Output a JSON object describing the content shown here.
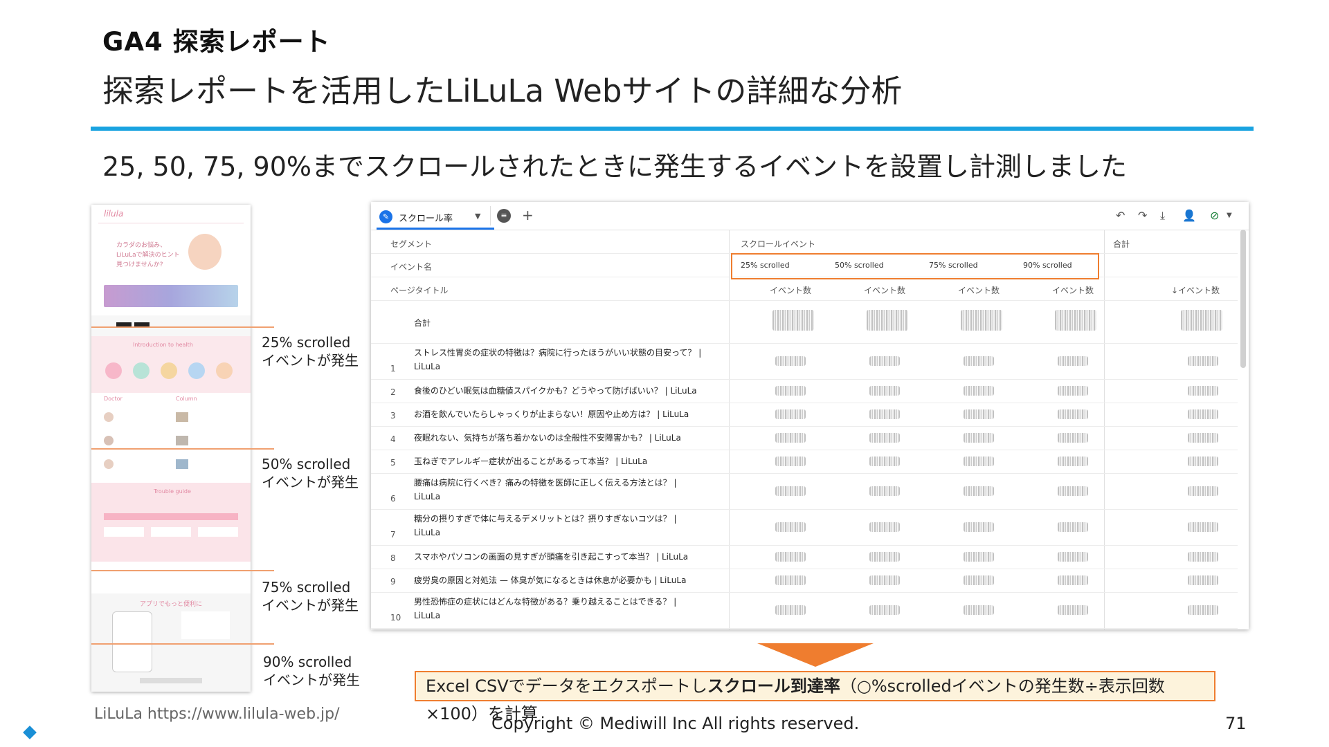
{
  "header": {
    "heading": "GA4 探索レポート",
    "subtitle": "探索レポートを活用したLiLuLa Webサイトの詳細な分析",
    "description": "25, 50, 75, 90%までスクロールされたときに発生するイベントを設置し計測しました"
  },
  "site_thumbnail": {
    "logo": "lilula",
    "hero_text": "カラダのお悩み、LiLuLaで解決のヒント見つけませんか?",
    "section_intro": "Introduction to health",
    "section_doctor": "Doctor",
    "section_column": "Column",
    "section_trouble": "Trouble guide",
    "section_app": "アプリでもっと便利に"
  },
  "scroll_labels": [
    {
      "event": "25% scrolled",
      "text": "イベントが発生"
    },
    {
      "event": "50% scrolled",
      "text": "イベントが発生"
    },
    {
      "event": "75% scrolled",
      "text": "イベントが発生"
    },
    {
      "event": "90% scrolled",
      "text": "イベントが発生"
    }
  ],
  "ga": {
    "tab_label": "スクロール率",
    "toolbar_icons": [
      "undo-icon",
      "redo-icon",
      "download-icon",
      "share-user-icon",
      "check-circle-icon"
    ],
    "row_labels": {
      "segment": "セグメント",
      "event_name": "イベント名",
      "page_title": "ページタイトル"
    },
    "segment_group": "スクロールイベント",
    "total_group": "合計",
    "events": [
      "25% scrolled",
      "50% scrolled",
      "75% scrolled",
      "90% scrolled"
    ],
    "metric": "イベント数",
    "metric_sorted": "↓イベント数",
    "total_row": "合計",
    "pages": [
      {
        "n": "1",
        "title": "ストレス性胃炎の症状の特徴は？病院に行ったほうがいい状態の目安って？ | LiLuLa"
      },
      {
        "n": "2",
        "title": "食後のひどい眠気は血糖値スパイクかも？どうやって防げばいい？ | LiLuLa"
      },
      {
        "n": "3",
        "title": "お酒を飲んでいたらしゃっくりが止まらない！原因や止め方は？ | LiLuLa"
      },
      {
        "n": "4",
        "title": "夜眠れない、気持ちが落ち着かないのは全般性不安障害かも？ | LiLuLa"
      },
      {
        "n": "5",
        "title": "玉ねぎでアレルギー症状が出ることがあるって本当？ | LiLuLa"
      },
      {
        "n": "6",
        "title": "腰痛は病院に行くべき？痛みの特徴を医師に正しく伝える方法とは？ | LiLuLa"
      },
      {
        "n": "7",
        "title": "糖分の摂りすぎで体に与えるデメリットとは？摂りすぎないコツは？ | LiLuLa"
      },
      {
        "n": "8",
        "title": "スマホやパソコンの画面の見すぎが頭痛を引き起こすって本当？ | LiLuLa"
      },
      {
        "n": "9",
        "title": "疲労臭の原因と対処法 — 体臭が気になるときは休息が必要かも | LiLuLa"
      },
      {
        "n": "10",
        "title": "男性恐怖症の症状にはどんな特徴がある？乗り越えることはできる？ | LiLuLa"
      }
    ]
  },
  "note": {
    "prefix": "Excel CSVでデータをエクスポートし",
    "bold": "スクロール到達率",
    "suffix": "（○%scrolledイベントの発生数÷表示回数×100）を計算"
  },
  "footer": {
    "source": "LiLuLa https://www.lilula-web.jp/",
    "copyright": "Copyright © Mediwill Inc All rights reserved.",
    "page_number": "71"
  },
  "colors": {
    "accent_blue": "#1aa3e0",
    "highlight_orange": "#ef7d2f",
    "note_bg": "#fdf3dc"
  }
}
